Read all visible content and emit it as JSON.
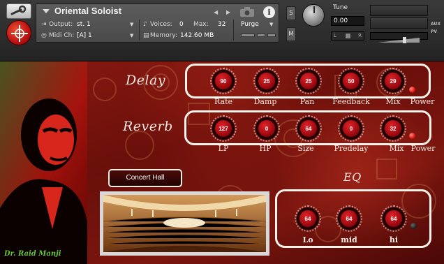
{
  "header": {
    "instrument_name": "Oriental Soloist",
    "output_label": "Output:",
    "output_value": "st. 1",
    "voices_label": "Voices:",
    "voices_value": "0",
    "max_label": "Max:",
    "max_value": "32",
    "purge_label": "Purge",
    "midi_label": "Midi Ch:",
    "midi_value": "[A] 1",
    "memory_label": "Memory:",
    "memory_value": "142.60 MB",
    "solo_label": "S",
    "mute_label": "M",
    "tune_label": "Tune",
    "tune_value": "0.00",
    "pan_left": "L",
    "pan_right": "R",
    "aux_label": "AUX",
    "pv_label": "PV",
    "info_glyph": "i"
  },
  "delay": {
    "title": "Delay",
    "power_label": "Power",
    "knobs": [
      {
        "label": "Rate",
        "value": "90"
      },
      {
        "label": "Damp",
        "value": "25"
      },
      {
        "label": "Pan",
        "value": "25"
      },
      {
        "label": "Feedback",
        "value": "50"
      },
      {
        "label": "Mix",
        "value": "29"
      }
    ]
  },
  "reverb": {
    "title": "Reverb",
    "power_label": "Power",
    "knobs": [
      {
        "label": "LP",
        "value": "127"
      },
      {
        "label": "HP",
        "value": "0"
      },
      {
        "label": "Size",
        "value": "64"
      },
      {
        "label": "Predelay",
        "value": "0"
      },
      {
        "label": "Mix",
        "value": "32"
      }
    ]
  },
  "impulse": {
    "button_label": "Concert Hall"
  },
  "eq": {
    "title": "EQ",
    "knobs": [
      {
        "label": "Lo",
        "value": "64"
      },
      {
        "label": "mid",
        "value": "64"
      },
      {
        "label": "hi",
        "value": "64"
      }
    ]
  },
  "signature": "Dr. Raid Manji",
  "colors": {
    "panel_red": "#7c160f",
    "knob_red": "#d0121a",
    "frame_white": "#f7f2ea",
    "power_led": "#e0150f",
    "signature_green": "#67c43a"
  }
}
